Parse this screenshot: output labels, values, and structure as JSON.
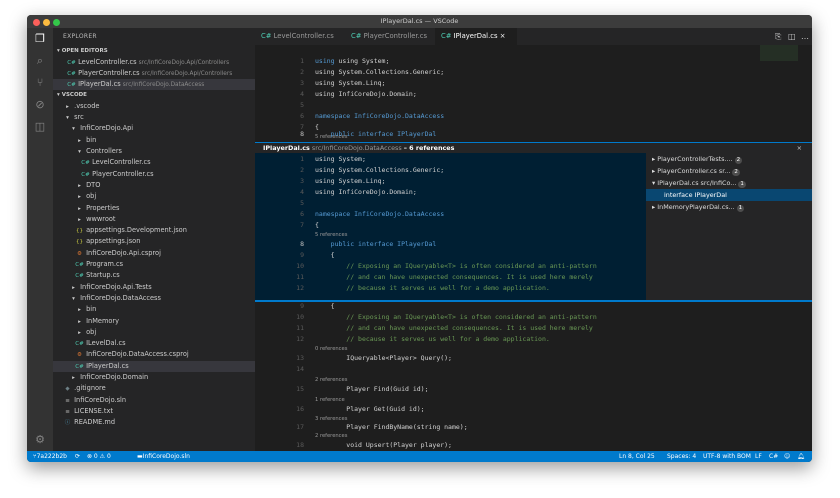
{
  "window": {
    "title": "IPlayerDal.cs — VSCode"
  },
  "sidebar": {
    "header": "EXPLORER",
    "open_editors_label": "OPEN EDITORS",
    "open_editors": [
      {
        "name": "LevelController.cs",
        "path": "src/InfiCoreDojo.Api/Controllers"
      },
      {
        "name": "PlayerController.cs",
        "path": "src/InfiCoreDojo.Api/Controllers"
      },
      {
        "name": "IPlayerDal.cs",
        "path": "src/InfiCoreDojo.DataAccess"
      }
    ],
    "workspace_label": "VSCODE",
    "tree": [
      {
        "label": ".vscode",
        "icon": "▸"
      },
      {
        "label": "src",
        "icon": "▾"
      },
      {
        "label": "InfiCoreDojo.Api",
        "icon": "▾"
      },
      {
        "label": "bin",
        "icon": "▸"
      },
      {
        "label": "Controllers",
        "icon": "▾"
      },
      {
        "label": "LevelController.cs",
        "icon": "C#"
      },
      {
        "label": "PlayerController.cs",
        "icon": "C#"
      },
      {
        "label": "DTO",
        "icon": "▸"
      },
      {
        "label": "obj",
        "icon": "▸"
      },
      {
        "label": "Properties",
        "icon": "▸"
      },
      {
        "label": "wwwroot",
        "icon": "▸"
      },
      {
        "label": "appsettings.Development.json",
        "icon": "{}"
      },
      {
        "label": "appsettings.json",
        "icon": "{}"
      },
      {
        "label": "InfiCoreDojo.Api.csproj",
        "icon": "⚙"
      },
      {
        "label": "Program.cs",
        "icon": "C#"
      },
      {
        "label": "Startup.cs",
        "icon": "C#"
      },
      {
        "label": "InfiCoreDojo.Api.Tests",
        "icon": "▸"
      },
      {
        "label": "InfiCoreDojo.DataAccess",
        "icon": "▾"
      },
      {
        "label": "bin",
        "icon": "▸"
      },
      {
        "label": "InMemory",
        "icon": "▸"
      },
      {
        "label": "obj",
        "icon": "▸"
      },
      {
        "label": "ILevelDal.cs",
        "icon": "C#"
      },
      {
        "label": "InfiCoreDojo.DataAccess.csproj",
        "icon": "⚙"
      },
      {
        "label": "IPlayerDal.cs",
        "icon": "C#"
      },
      {
        "label": "InfiCoreDojo.Domain",
        "icon": "▸"
      },
      {
        "label": ".gitignore",
        "icon": "◆"
      },
      {
        "label": "InfiCoreDojo.sln",
        "icon": "≡"
      },
      {
        "label": "LICENSE.txt",
        "icon": "≡"
      },
      {
        "label": "README.md",
        "icon": "ⓘ"
      }
    ]
  },
  "tabs": [
    {
      "label": "LevelController.cs"
    },
    {
      "label": "PlayerController.cs"
    },
    {
      "label": "IPlayerDal.cs",
      "close": "×"
    }
  ],
  "peek": {
    "file": "IPlayerDal.cs",
    "path": "src/InfiCoreDojo.DataAccess",
    "refs": "– 6 references",
    "close": "×",
    "results": [
      {
        "label": "PlayerControllerTests....",
        "count": "2"
      },
      {
        "label": "PlayerController.cs sr...",
        "count": "2"
      },
      {
        "label": "IPlayerDal.cs src/InfiCo...",
        "count": "1"
      },
      {
        "label": "interface IPlayerDal",
        "count": ""
      },
      {
        "label": "InMemoryPlayerDal.cs...",
        "count": "1"
      }
    ]
  },
  "code": {
    "lines": {
      "l1": "using System;",
      "l2": "using System.Collections.Generic;",
      "l3": "using System.Linq;",
      "l4": "using InfiCoreDojo.Domain;",
      "l6": "namespace InfiCoreDojo.DataAccess",
      "l7": "{",
      "l8": "    public interface IPlayerDal",
      "l9": "    {",
      "l10": "        // Exposing an IQueryable<T> is often considered an anti-pattern",
      "l11": "        // and can have unexpected consequences. It is used here merely",
      "l12": "        // because it serves us well for a demo application.",
      "l13": "        IQueryable<Player> Query();",
      "l15": "        Player Find(Guid id);",
      "l16": "        Player Get(Guid id);",
      "l17": "        Player FindByName(string name);",
      "l18": "        void Upsert(Player player);",
      "l19": "    }",
      "l20": "}"
    },
    "refs": {
      "five": "5 references",
      "zero": "0 references",
      "two": "2 references",
      "one": "1 reference",
      "three": "3 references"
    }
  },
  "status": {
    "branch": "7a222b2b",
    "sync": "⟳",
    "errors": "⊗ 0 ⚠ 0",
    "solution": "InfiCoreDojo.sln",
    "position": "Ln 8, Col 25",
    "spaces": "Spaces: 4",
    "encoding": "UTF-8 with BOM",
    "eol": "LF",
    "language": "C#"
  }
}
